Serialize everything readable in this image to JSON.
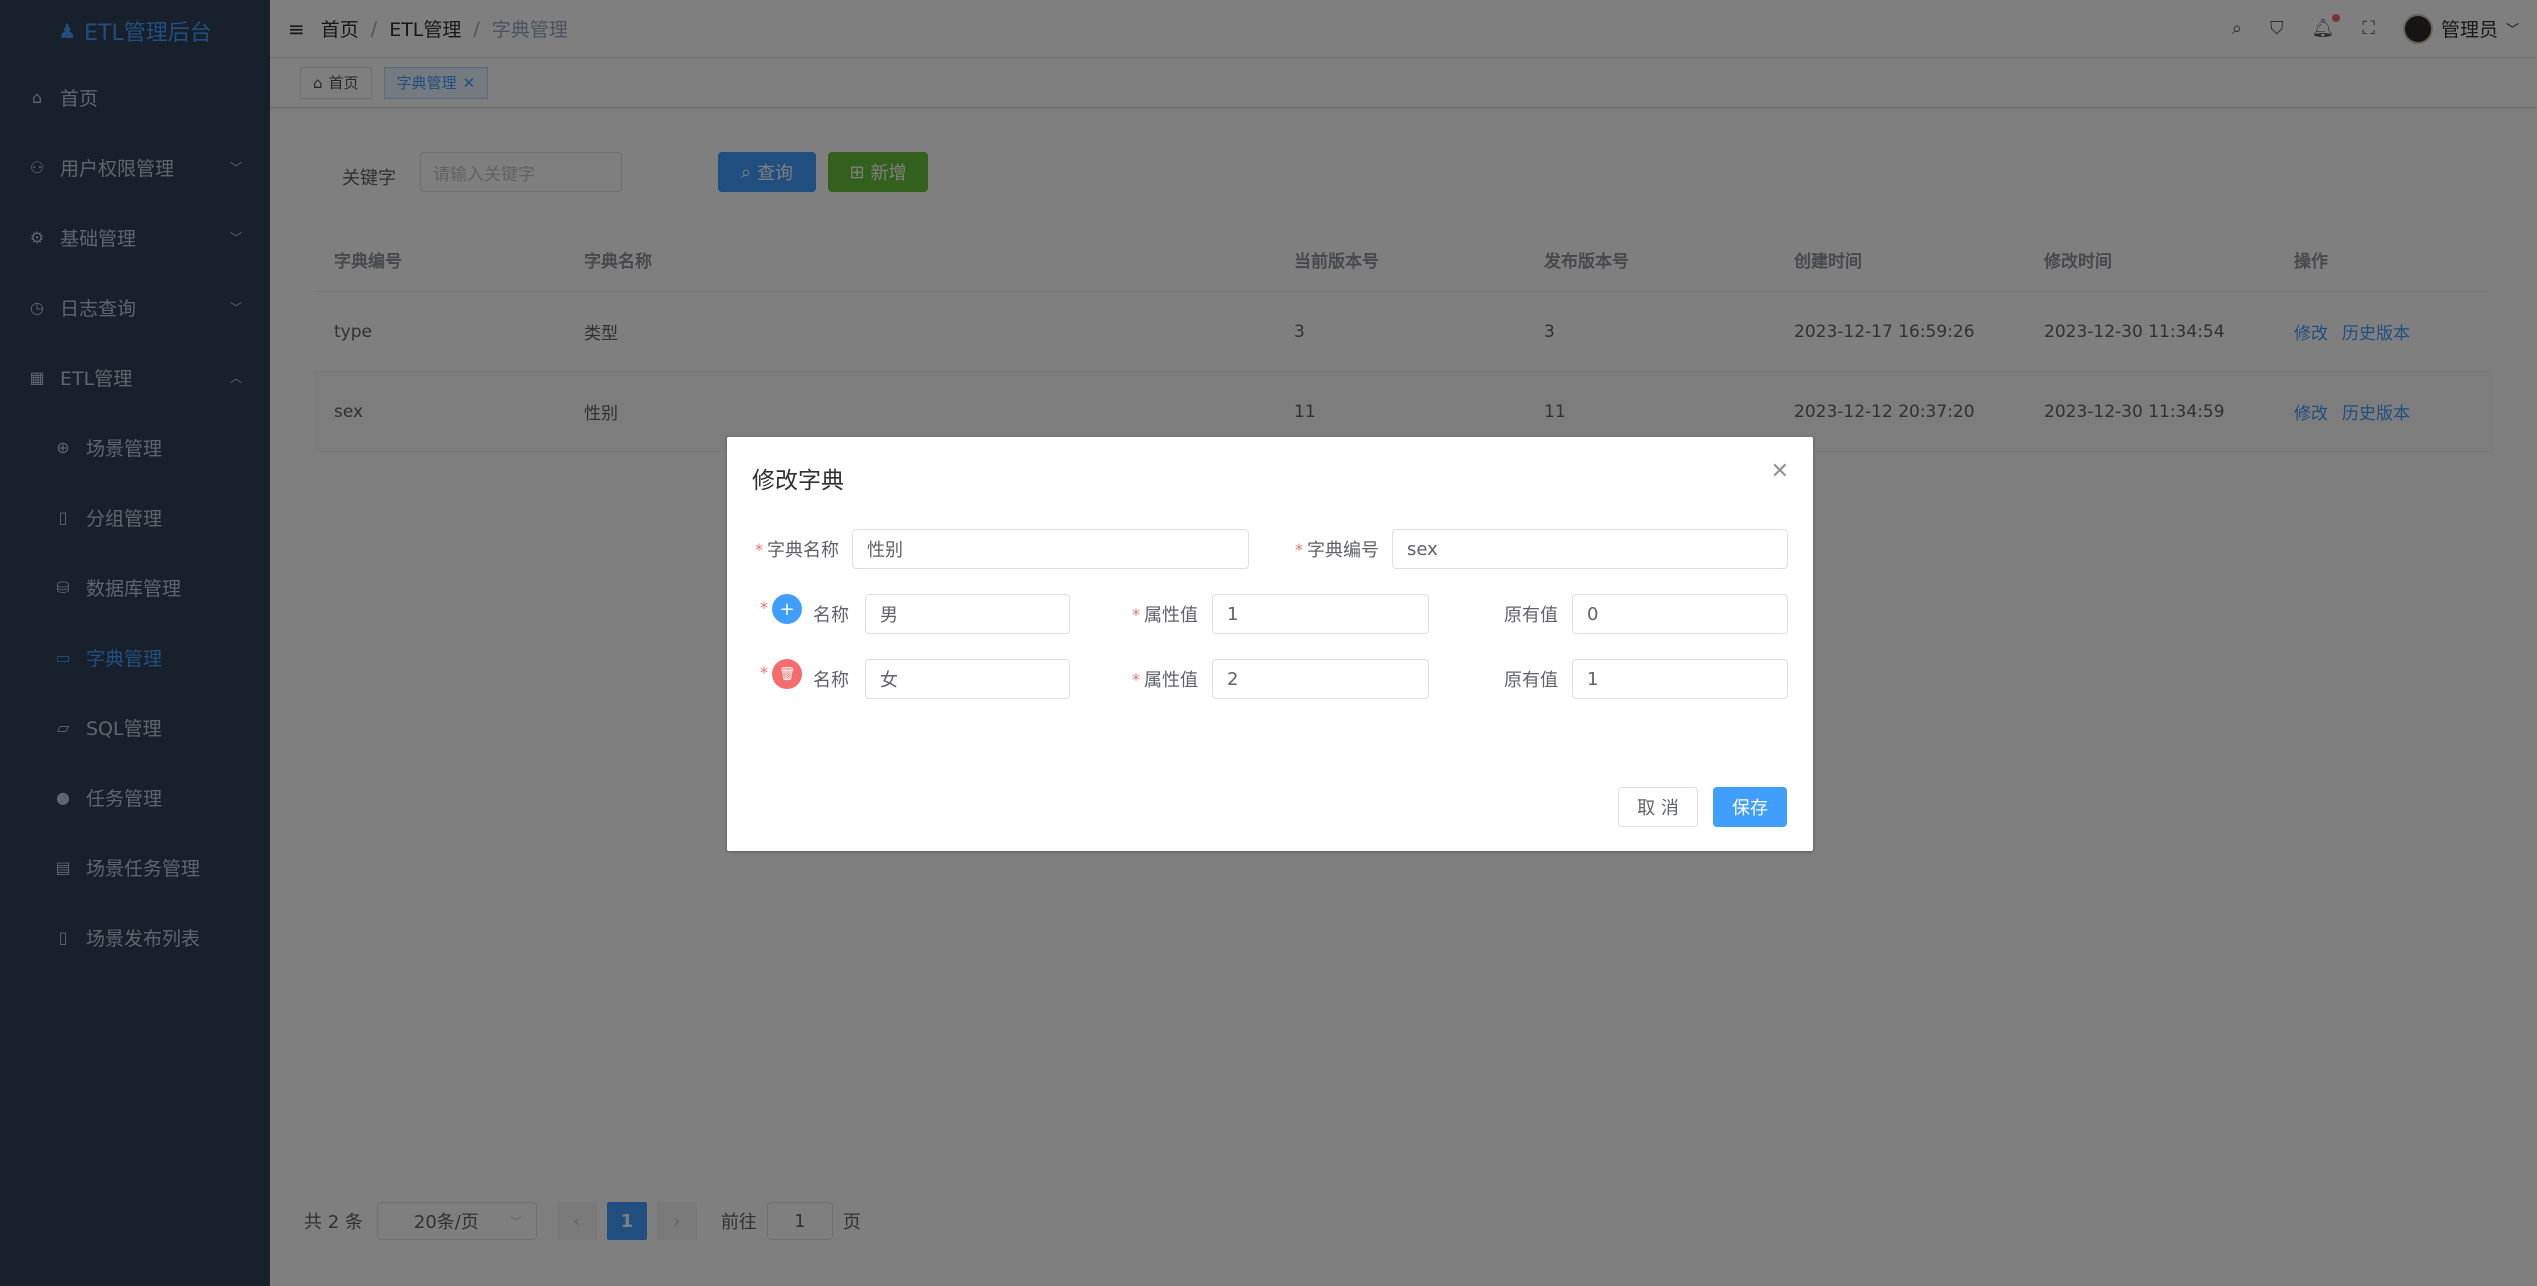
{
  "sidebar": {
    "logo_text": "ETL管理后台",
    "items": [
      {
        "label": "首页"
      },
      {
        "label": "用户权限管理"
      },
      {
        "label": "基础管理"
      },
      {
        "label": "日志查询"
      },
      {
        "label": "ETL管理"
      }
    ],
    "sub_items": [
      {
        "label": "场景管理"
      },
      {
        "label": "分组管理"
      },
      {
        "label": "数据库管理"
      },
      {
        "label": "字典管理"
      },
      {
        "label": "SQL管理"
      },
      {
        "label": "任务管理"
      },
      {
        "label": "场景任务管理"
      },
      {
        "label": "场景发布列表"
      }
    ]
  },
  "navbar": {
    "breadcrumb": [
      "首页",
      "ETL管理",
      "字典管理"
    ],
    "separator": "/",
    "user_name": "管理员"
  },
  "tags": [
    {
      "label": "首页"
    },
    {
      "label": "字典管理"
    }
  ],
  "search": {
    "label": "关键字",
    "placeholder": "请输入关键字",
    "query_button": "查询",
    "add_button": "新增"
  },
  "table": {
    "headers": [
      "字典编号",
      "字典名称",
      "当前版本号",
      "发布版本号",
      "创建时间",
      "修改时间",
      "操作"
    ],
    "rows": [
      {
        "code": "type",
        "name": "类型",
        "current_version": "3",
        "publish_version": "3",
        "created": "2023-12-17 16:59:26",
        "modified": "2023-12-30 11:34:54",
        "actions": [
          "修改",
          "历史版本"
        ]
      },
      {
        "code": "sex",
        "name": "性别",
        "current_version": "11",
        "publish_version": "11",
        "created": "2023-12-12 20:37:20",
        "modified": "2023-12-30 11:34:59",
        "actions": [
          "修改",
          "历史版本"
        ]
      }
    ]
  },
  "pagination": {
    "total_text": "共 2 条",
    "page_size": "20条/页",
    "current_page": "1",
    "goto_label": "前往",
    "goto_value": "1",
    "page_suffix": "页"
  },
  "dialog": {
    "title": "修改字典",
    "dict_name_label": "字典名称",
    "dict_name_value": "性别",
    "dict_code_label": "字典编号",
    "dict_code_value": "sex",
    "rows": [
      {
        "name_label": "名称",
        "name_value": "男",
        "attr_label": "属性值",
        "attr_value": "1",
        "orig_label": "原有值",
        "orig_value": "0"
      },
      {
        "name_label": "名称",
        "name_value": "女",
        "attr_label": "属性值",
        "attr_value": "2",
        "orig_label": "原有值",
        "orig_value": "1"
      }
    ],
    "required_mark": "*",
    "cancel_button": "取 消",
    "save_button": "保存"
  },
  "colors": {
    "sidebar_bg": "#304156",
    "primary": "#409eff",
    "success": "#67c23a",
    "danger": "#f56c6c"
  }
}
